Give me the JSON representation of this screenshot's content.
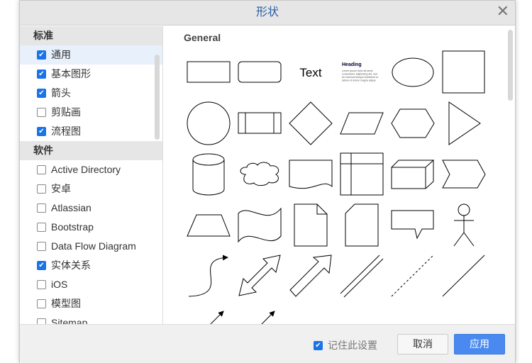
{
  "dialog": {
    "title": "形状",
    "close_icon": "close-icon"
  },
  "sidebar": {
    "categories": [
      {
        "label": "标准",
        "items": [
          {
            "label": "通用",
            "checked": true,
            "selected": true
          },
          {
            "label": "基本图形",
            "checked": true
          },
          {
            "label": "箭头",
            "checked": true
          },
          {
            "label": "剪贴画",
            "checked": false
          },
          {
            "label": "流程图",
            "checked": true
          }
        ]
      },
      {
        "label": "软件",
        "items": [
          {
            "label": "Active Directory",
            "checked": false
          },
          {
            "label": "安卓",
            "checked": false
          },
          {
            "label": "Atlassian",
            "checked": false
          },
          {
            "label": "Bootstrap",
            "checked": false
          },
          {
            "label": "Data Flow Diagram",
            "checked": false
          },
          {
            "label": "实体关系",
            "checked": true
          },
          {
            "label": "iOS",
            "checked": false
          },
          {
            "label": "模型图",
            "checked": false
          },
          {
            "label": "Sitemap",
            "checked": false
          }
        ]
      }
    ]
  },
  "shapes": {
    "group_title": "General",
    "text_shape": "Text",
    "heading_shape": {
      "heading": "Heading",
      "body": [
        "Lorem ipsum dolor sit amet,",
        "consectetur adipisicing elit, sed",
        "do eiusmod tempor incididunt ut",
        "labore et dolore magna aliqua."
      ]
    },
    "items": [
      "rectangle",
      "rounded-rectangle",
      "text",
      "textbox",
      "ellipse",
      "square",
      "circle",
      "process",
      "diamond",
      "parallelogram",
      "hexagon",
      "triangle",
      "cylinder",
      "cloud",
      "document",
      "internal-storage",
      "cube",
      "step",
      "trapezoid",
      "tape",
      "note",
      "card",
      "callout",
      "actor",
      "curved-arrow",
      "bidirectional-arrow",
      "arrow",
      "link",
      "dashed-line",
      "line",
      "arrow-line",
      "arrow-line"
    ]
  },
  "footer": {
    "remember_label": "记住此设置",
    "remember_checked": true,
    "cancel_label": "取消",
    "apply_label": "应用"
  },
  "colors": {
    "accent": "#4a8af0",
    "title": "#2a5ea8"
  }
}
